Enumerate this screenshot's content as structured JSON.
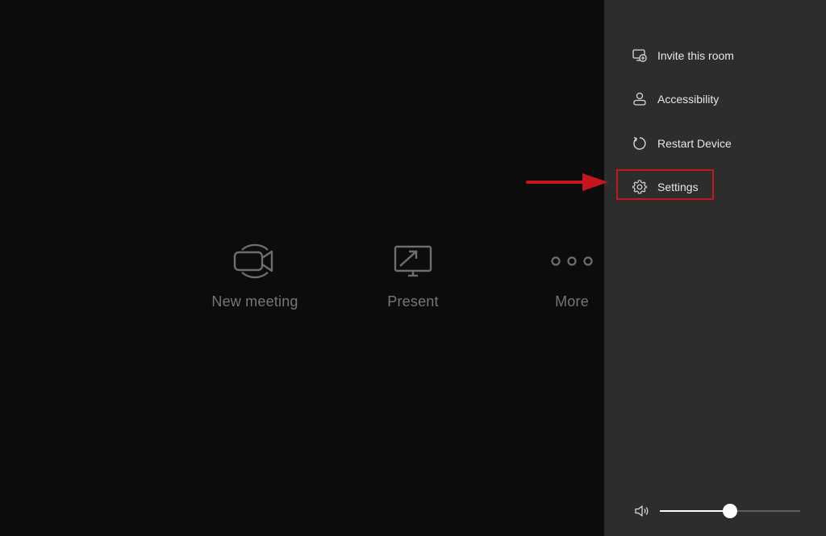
{
  "actions": {
    "new_meeting": {
      "label": "New meeting",
      "icon": "video-camera-icon"
    },
    "present": {
      "label": "Present",
      "icon": "screen-share-icon"
    },
    "more": {
      "label": "More",
      "icon": "more-dots-icon"
    }
  },
  "panel": {
    "items": [
      {
        "label": "Invite this room",
        "icon": "invite-room-icon"
      },
      {
        "label": "Accessibility",
        "icon": "accessibility-icon"
      },
      {
        "label": "Restart Device",
        "icon": "restart-icon"
      },
      {
        "label": "Settings",
        "icon": "gear-icon",
        "highlighted": true
      }
    ]
  },
  "volume": {
    "level": 0.5,
    "icon": "speaker-icon"
  },
  "annotation": {
    "color": "#c4161c",
    "target": "Settings"
  },
  "colors": {
    "background": "#0c0c0c",
    "panel": "#2d2d2d",
    "muted_text": "#767676",
    "panel_text": "#e6e6e6"
  }
}
